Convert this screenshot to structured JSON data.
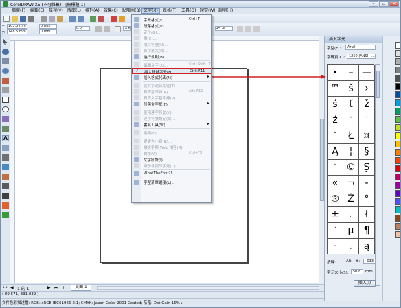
{
  "window": {
    "title": "CorelDRAW X5 (不可雜數) - [無標題-1]",
    "controls": [
      "–",
      "▫",
      "✕"
    ]
  },
  "menubar": {
    "items": [
      "檔案(F)",
      "編輯(E)",
      "檢視(V)",
      "版面(L)",
      "排列(A)",
      "效果(C)",
      "點陣圖(B)",
      "文字(X)",
      "表格(T)",
      "工具(O)",
      "視窗(W)",
      "說明(H)"
    ],
    "active_index": 7
  },
  "toolbar2": {
    "x_label": "x:",
    "x_value": "105.0 mm",
    "y_label": "y:",
    "y_value": "148.5 mm",
    "w_value": "0 mm",
    "h_value": "0 mm",
    "angle_value": "0.0",
    "font_value": "文義",
    "font_size_value": "24 pt"
  },
  "text_menu": {
    "items": [
      {
        "label": "字元格式(F)",
        "shortcut": "Ctrl+T",
        "disabled": false,
        "submenu": false
      },
      {
        "label": "段落格式(P)",
        "shortcut": "",
        "disabled": false,
        "submenu": false
      },
      {
        "label": "定位(G)...",
        "shortcut": "",
        "disabled": true,
        "submenu": false
      },
      {
        "label": "欄(C)...",
        "shortcut": "",
        "disabled": true,
        "submenu": false
      },
      {
        "label": "項目符號(U)...",
        "shortcut": "",
        "disabled": true,
        "submenu": false
      },
      {
        "label": "首字放大(D)...",
        "shortcut": "",
        "disabled": true,
        "submenu": false
      },
      {
        "label": "換行規則(B)...",
        "shortcut": "",
        "disabled": false,
        "submenu": false
      },
      {
        "sep": true
      },
      {
        "label": "編輯文字(X)...",
        "shortcut": "Ctrl+Shift+T",
        "disabled": true,
        "submenu": false
      },
      {
        "label": "插入符號字元(H)",
        "shortcut": "Ctrl+F11",
        "disabled": false,
        "submenu": false,
        "checked": true,
        "highlight": true
      },
      {
        "label": "插入格式代碼(M)",
        "shortcut": "",
        "disabled": false,
        "submenu": true
      },
      {
        "sep": true
      },
      {
        "label": "使文字適合路徑(T)",
        "shortcut": "",
        "disabled": true,
        "submenu": false
      },
      {
        "label": "對齊基準線(A)",
        "shortcut": "Alt+F12",
        "disabled": true,
        "submenu": false
      },
      {
        "label": "對齊文字基準線(V)",
        "shortcut": "",
        "disabled": true,
        "submenu": false
      },
      {
        "label": "段落文字框(F)",
        "shortcut": "",
        "disabled": false,
        "submenu": true
      },
      {
        "sep": true
      },
      {
        "label": "使用連字符號(Y)",
        "shortcut": "",
        "disabled": true,
        "submenu": false
      },
      {
        "label": "連字符號設定(S)...",
        "shortcut": "",
        "disabled": true,
        "submenu": false
      },
      {
        "label": "書寫工具(W)",
        "shortcut": "",
        "disabled": false,
        "submenu": true
      },
      {
        "sep": true
      },
      {
        "label": "編碼(E)...",
        "shortcut": "",
        "disabled": true,
        "submenu": false
      },
      {
        "sep": true
      },
      {
        "label": "變更大小寫(N)...",
        "shortcut": "",
        "disabled": true,
        "submenu": false
      },
      {
        "label": "讓文字與 Web 相容(R)",
        "shortcut": "",
        "disabled": true,
        "submenu": false
      },
      {
        "label": "轉換(V)",
        "shortcut": "Ctrl+F8",
        "disabled": true,
        "submenu": false
      },
      {
        "label": "文字統計(I)...",
        "shortcut": "",
        "disabled": false,
        "submenu": false
      },
      {
        "label": "顯示非列印字元(C)",
        "shortcut": "",
        "disabled": true,
        "submenu": false
      },
      {
        "sep": true
      },
      {
        "label": "WhatTheFont?!...",
        "shortcut": "",
        "disabled": false,
        "submenu": false
      },
      {
        "sep": true
      },
      {
        "label": "字型清單選項(L)...",
        "shortcut": "",
        "disabled": false,
        "submenu": false
      }
    ]
  },
  "docker": {
    "title": "插入字元",
    "font_label": "字型(F):",
    "font_value": "Arial",
    "subset_label": "字碼頁(C):",
    "subset_value": "1250 (ANSI - ...",
    "glyphs": [
      "•",
      "–",
      "—",
      "™",
      "š",
      "›",
      "ś",
      "ť",
      "ž",
      "ź",
      "ˇ",
      "˘",
      "˘",
      "Ł",
      "¤",
      "Ą",
      "¦",
      "§",
      "¨",
      "©",
      "Ş",
      "«",
      "¬",
      "-",
      "®",
      "Ż",
      "°",
      "±",
      "˛",
      "ł",
      "´",
      "µ",
      "¶",
      "·",
      "¸",
      "ą"
    ],
    "keystroke_label": "按鍵:",
    "keystroke_prefix": "Alt +",
    "keystroke_hash": "#:",
    "keystroke_value": "033",
    "char_size_label": "字元大小(S):",
    "char_size_value": "50.8",
    "char_size_unit": "mm",
    "insert_button": "插入(I)"
  },
  "page_nav": {
    "counter": "1 的 1",
    "page_tab": "頁面 1"
  },
  "status": {
    "coords": "( 89.571, 331.039 )",
    "color_profile": "文件色彩描述檔: RGB: sRGB IEC61966-2.1; CMYK: Japan Color 2001 Coated; 灰階: Dot Gain 15% ▸"
  },
  "colors": {
    "highlight_border": "#cc2222",
    "arrow": "#cc2222",
    "palette": [
      "#ffffff",
      "#e0e0e0",
      "#b0b0b0",
      "#808080",
      "#505050",
      "#000000",
      "#0050a0",
      "#00a0e0",
      "#00a060",
      "#60c040",
      "#c0e020",
      "#ffff00",
      "#ffc000",
      "#ff8000",
      "#ff4000",
      "#e00000",
      "#c00060",
      "#a000a0",
      "#6000c0",
      "#5050ff",
      "#00c0c0",
      "#8b4513",
      "#c08060",
      "#f0c0a0"
    ]
  }
}
